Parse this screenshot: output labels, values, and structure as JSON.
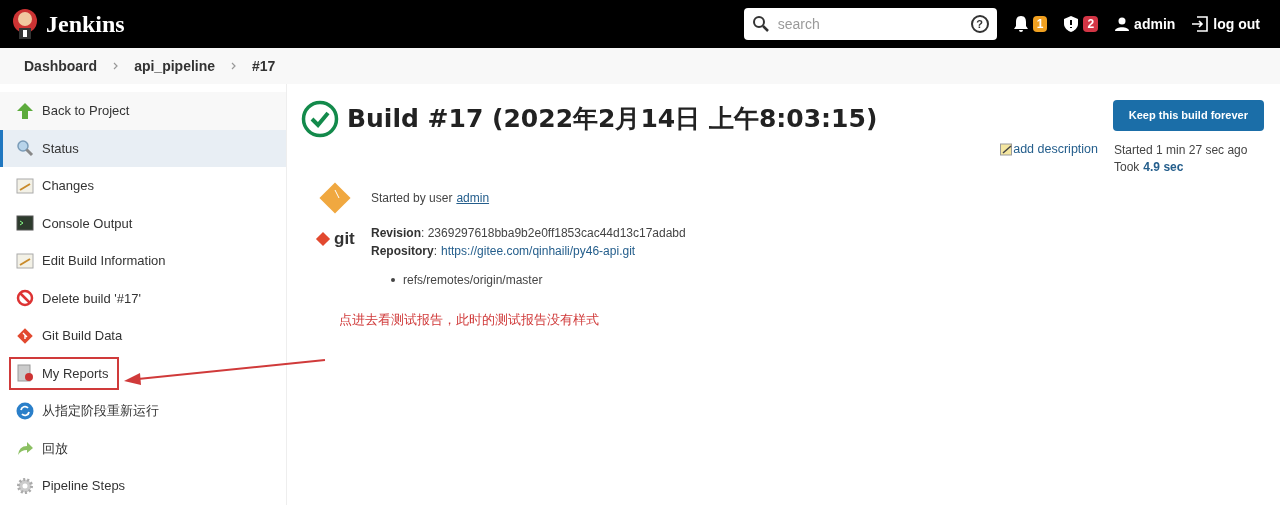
{
  "header": {
    "logo": "Jenkins",
    "search": {
      "placeholder": "search"
    },
    "help": "?",
    "notifications": "1",
    "security": "2",
    "user": "admin",
    "logout": "log out"
  },
  "breadcrumbs": [
    "Dashboard",
    "api_pipeline",
    "#17"
  ],
  "sidebar": {
    "items": [
      {
        "label": "Back to Project",
        "selected": false,
        "highlighted": false
      },
      {
        "label": "Status",
        "selected": true,
        "highlighted": false
      },
      {
        "label": "Changes",
        "selected": false,
        "highlighted": false
      },
      {
        "label": "Console Output",
        "selected": false,
        "highlighted": false
      },
      {
        "label": "Edit Build Information",
        "selected": false,
        "highlighted": false
      },
      {
        "label": "Delete build '#17'",
        "selected": false,
        "highlighted": false
      },
      {
        "label": "Git Build Data",
        "selected": false,
        "highlighted": false
      },
      {
        "label": "My Reports",
        "selected": false,
        "highlighted": true
      },
      {
        "label": "从指定阶段重新运行",
        "selected": false,
        "highlighted": false
      },
      {
        "label": "回放",
        "selected": false,
        "highlighted": false
      },
      {
        "label": "Pipeline Steps",
        "selected": false,
        "highlighted": false
      }
    ]
  },
  "build": {
    "title": "Build #17 (2022年2月14日 上午8:03:15)",
    "keep_button": "Keep this build forever",
    "add_description": "add description",
    "started": "Started 1 min 27 sec ago",
    "took_label": "Took",
    "took_value": "4.9 sec",
    "started_by": "Started by user",
    "started_by_user": "admin",
    "git_label": "git",
    "revision": "**Revision**: 2369297618bba9b2e0ff1853cac44d13c17adabd",
    "repository_label": "**Repository**:",
    "repository": "https://gitee.com/qinhaili/py46-api.git",
    "branches": [
      "refs/remotes/origin/master"
    ]
  },
  "annotation": {
    "text": "点进去看测试报告，此时的测试报告没有样式"
  }
}
